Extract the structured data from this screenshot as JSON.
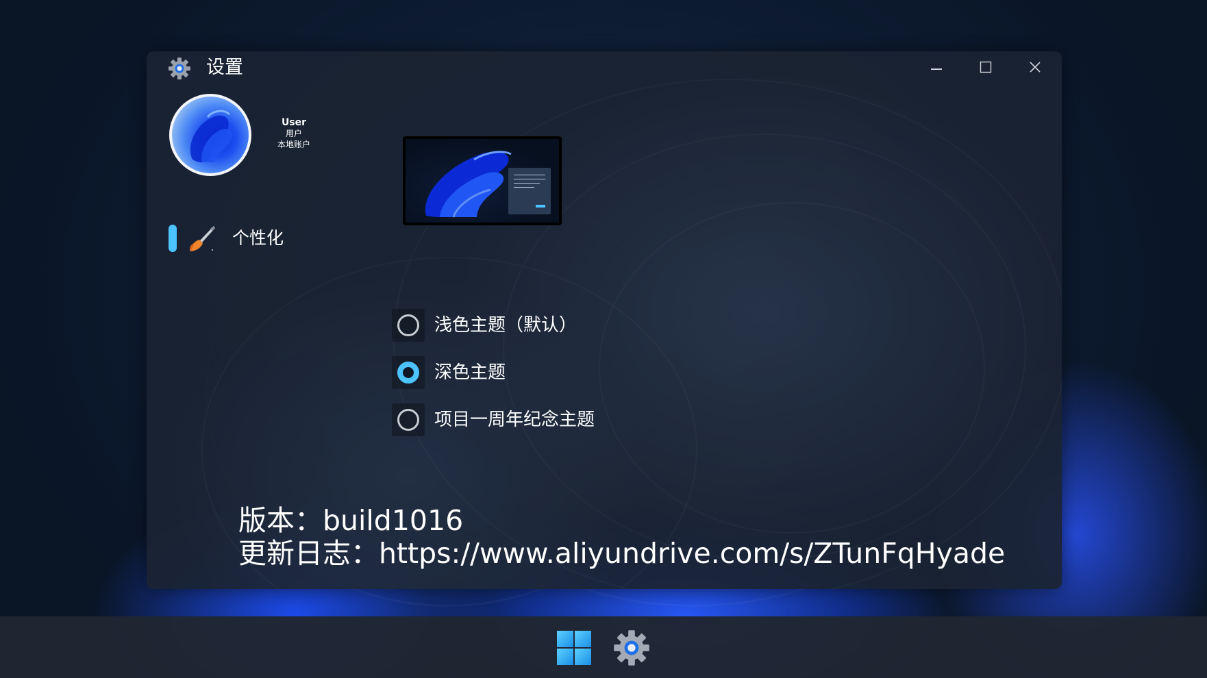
{
  "window": {
    "title": "设置",
    "controls": {
      "minimize": "minimize-icon",
      "maximize": "maximize-icon",
      "close": "close-icon"
    }
  },
  "user": {
    "name": "User",
    "role": "用户",
    "account_type": "本地账户"
  },
  "sidebar": {
    "items": [
      {
        "label": "个性化",
        "icon": "paintbrush-icon",
        "selected": true
      }
    ]
  },
  "themes": {
    "options": [
      {
        "label": "浅色主题（默认）",
        "selected": false
      },
      {
        "label": "深色主题",
        "selected": true
      },
      {
        "label": "项目一周年纪念主题",
        "selected": false
      }
    ]
  },
  "footer": {
    "version": "版本：build1016",
    "changelog": "更新日志：https://www.aliyundrive.com/s/ZTunFqHyade"
  },
  "taskbar": {
    "items": [
      "windows-start-icon",
      "settings-gear-icon"
    ]
  },
  "colors": {
    "accent": "#4cc2ff",
    "window_bg": "#1b2433",
    "taskbar_bg": "#202632"
  }
}
